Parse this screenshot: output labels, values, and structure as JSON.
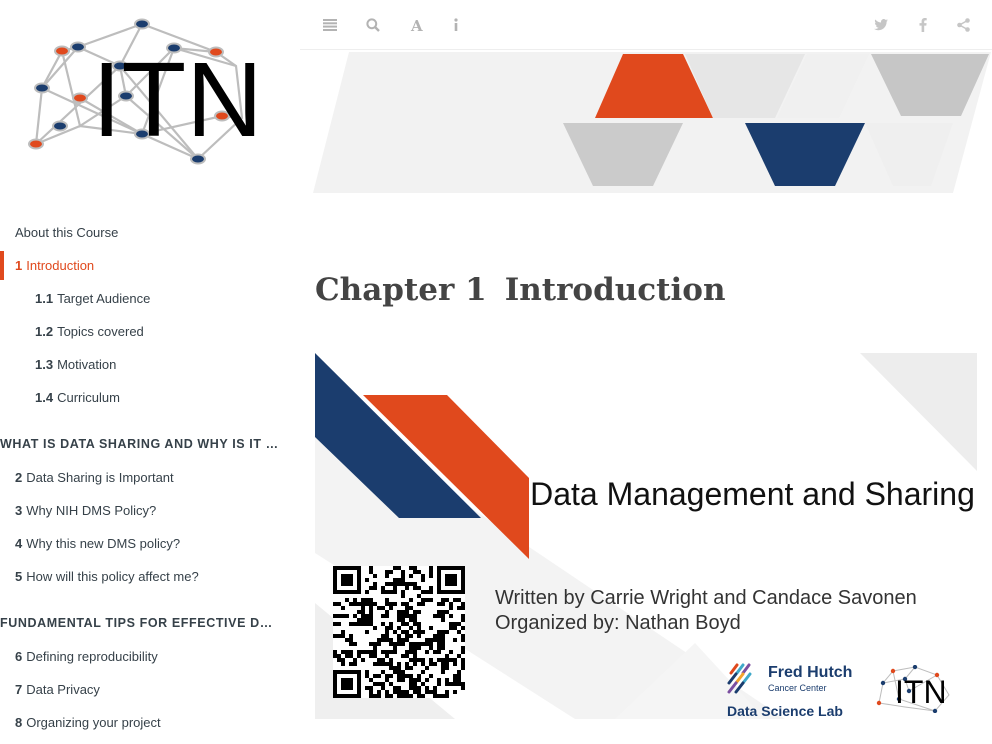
{
  "logo": {
    "text": "ITN"
  },
  "toc": [
    {
      "num": "",
      "label": "About this Course",
      "level": 0,
      "active": false
    },
    {
      "num": "1",
      "label": "Introduction",
      "level": 0,
      "active": true
    },
    {
      "num": "1.1",
      "label": "Target Audience",
      "level": 1,
      "active": false
    },
    {
      "num": "1.2",
      "label": "Topics covered",
      "level": 1,
      "active": false
    },
    {
      "num": "1.3",
      "label": "Motivation",
      "level": 1,
      "active": false
    },
    {
      "num": "1.4",
      "label": "Curriculum",
      "level": 1,
      "active": false
    },
    {
      "part": "WHAT IS DATA SHARING AND WHY IS IT IMPORTANT"
    },
    {
      "num": "2",
      "label": "Data Sharing is Important",
      "level": 0,
      "active": false
    },
    {
      "num": "3",
      "label": "Why NIH DMS Policy?",
      "level": 0,
      "active": false
    },
    {
      "num": "4",
      "label": "Why this new DMS policy?",
      "level": 0,
      "active": false
    },
    {
      "num": "5",
      "label": "How will this policy affect me?",
      "level": 0,
      "active": false
    },
    {
      "part": "FUNDAMENTAL TIPS FOR EFFECTIVE DATA MANAGEMENT"
    },
    {
      "num": "6",
      "label": "Defining reproducibility",
      "level": 0,
      "active": false
    },
    {
      "num": "7",
      "label": "Data Privacy",
      "level": 0,
      "active": false
    },
    {
      "num": "8",
      "label": "Organizing your project",
      "level": 0,
      "active": false
    }
  ],
  "toolbar": {
    "left": [
      "menu-icon",
      "search-icon",
      "font-icon",
      "info-icon"
    ],
    "right": [
      "twitter-icon",
      "facebook-icon",
      "share-icon"
    ]
  },
  "chapter": {
    "number": "Chapter 1",
    "title": "Introduction"
  },
  "slide": {
    "title": "Data Management and Sharing",
    "written_by": "Written by Carrie Wright and Candace Savonen",
    "organized_by": "Organized by: Nathan Boyd",
    "fh_name": "Fred Hutch",
    "fh_sub": "Cancer Center",
    "fh_lab": "Data Science Lab",
    "itn": "ITN"
  },
  "colors": {
    "accent": "#e0491d",
    "navy": "#1b3d6e",
    "grey": "#c9c9c9",
    "text": "#364149"
  }
}
